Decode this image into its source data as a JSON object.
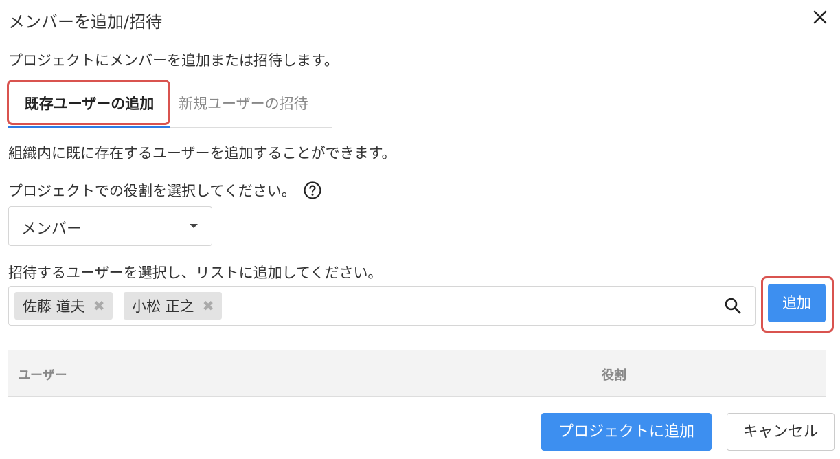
{
  "dialog": {
    "title": "メンバーを追加/招待",
    "description": "プロジェクトにメンバーを追加または招待します。"
  },
  "tabs": [
    {
      "label": "既存ユーザーの追加",
      "active": true
    },
    {
      "label": "新規ユーザーの招待",
      "active": false
    }
  ],
  "existing_tab": {
    "description": "組織内に既に存在するユーザーを追加することができます。",
    "role_prompt": "プロジェクトでの役割を選択してください。",
    "role_select": {
      "value": "メンバー"
    },
    "user_prompt": "招待するユーザーを選択し、リストに追加してください。",
    "selected_users": [
      {
        "name": "佐藤 道夫",
        "remove": "✖"
      },
      {
        "name": "小松 正之",
        "remove": "✖"
      }
    ],
    "add_button": "追加"
  },
  "table": {
    "columns": [
      "ユーザー",
      "役割"
    ]
  },
  "footer": {
    "primary_button": "プロジェクトに追加",
    "cancel_button": "キャンセル"
  },
  "icons": {
    "close": "close-icon",
    "help": "question-circle-icon",
    "search": "search-icon",
    "dropdown": "caret-down-icon"
  },
  "colors": {
    "primary": "#3d8ff0",
    "highlight": "#d9534f",
    "tab_underline": "#2c7be5"
  }
}
